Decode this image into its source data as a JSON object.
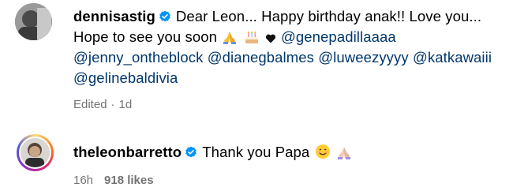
{
  "comments": [
    {
      "username": "dennisastig",
      "verified": true,
      "text_intro": "Dear Leon... Happy birthday anak!! Love you...",
      "text_line2": "Hope to see you soon",
      "mentions": [
        "@genepadillaaaa",
        "@jenny_ontheblock",
        "@dianegbalmes",
        "@luweezyyyy",
        "@katkawaiii",
        "@gelinebaldivia"
      ],
      "edited": "Edited",
      "separator": "·",
      "time": "1d",
      "icons": [
        "verified-badge-icon",
        "praying-hands-emoji",
        "birthday-cake-emoji",
        "black-heart-emoji"
      ]
    },
    {
      "username": "theleonbarretto",
      "verified": true,
      "text": "Thank you Papa",
      "time": "16h",
      "likes": "918 likes",
      "icons": [
        "verified-badge-icon",
        "smiling-face-emoji",
        "praying-hands-emoji"
      ]
    }
  ],
  "colors": {
    "mention": "#00376b",
    "meta": "#737373",
    "verified": "#0095f6"
  }
}
